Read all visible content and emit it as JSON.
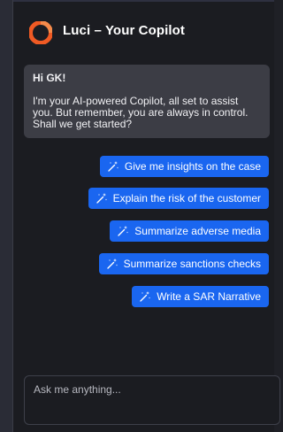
{
  "header": {
    "title": "Luci – Your Copilot",
    "logo_icon": "luci-logo-icon",
    "logo_color": "#f05a24"
  },
  "greeting": {
    "title": "Hi GK!",
    "body": "I'm your AI-powered Copilot, all set to assist you. But remember, you are always in control. Shall we get started?"
  },
  "suggestions": [
    {
      "label": "Give me insights on the case",
      "icon": "magic-wand-icon"
    },
    {
      "label": "Explain the risk of the customer",
      "icon": "magic-wand-icon"
    },
    {
      "label": "Summarize adverse media",
      "icon": "magic-wand-icon"
    },
    {
      "label": "Summarize sanctions checks",
      "icon": "magic-wand-icon"
    },
    {
      "label": "Write a SAR Narrative",
      "icon": "magic-wand-icon"
    }
  ],
  "input": {
    "placeholder": "Ask me anything..."
  },
  "colors": {
    "accent": "#1a66f0",
    "panel": "#1b1c21",
    "bubble": "#3c3d45"
  }
}
